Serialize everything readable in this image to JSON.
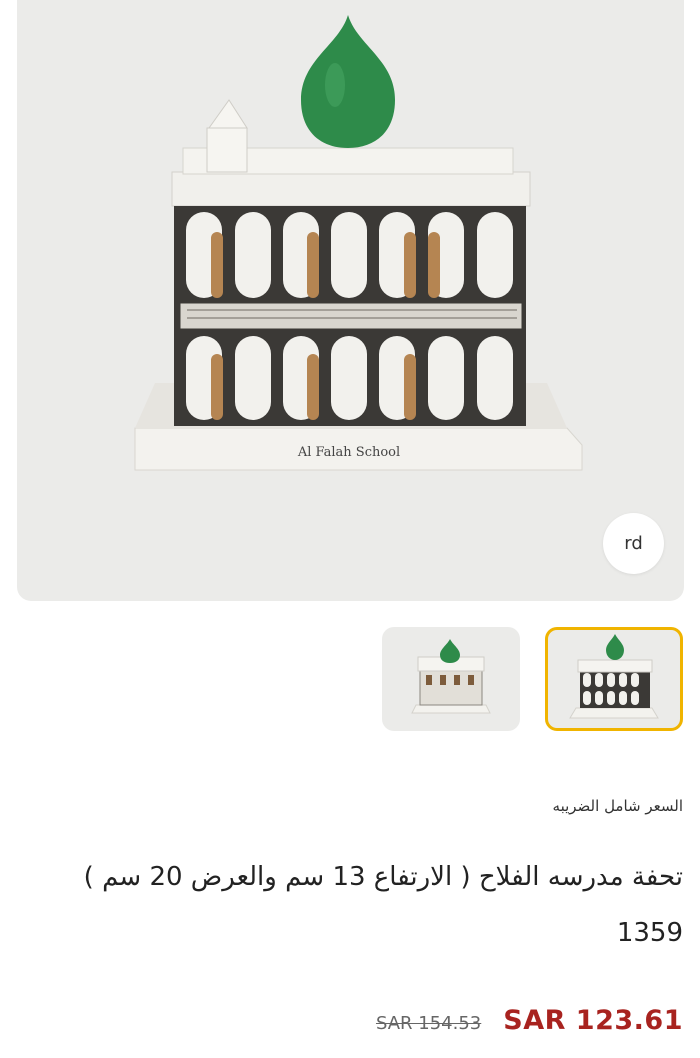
{
  "product": {
    "image_alt": "Al Falah School",
    "badge": "rd",
    "model_caption": "Al Falah School",
    "tax_note": "السعر شامل الضريبه",
    "title": "تحفة مدرسه الفلاح ( الارتفاع 13 سم والعرض 20 سم ) 1359",
    "old_price": "SAR 154.53",
    "new_price": "SAR 123.61"
  },
  "gallery": {
    "thumbnails": [
      {
        "label": "thumbnail-1",
        "selected": false
      },
      {
        "label": "thumbnail-2",
        "selected": true
      }
    ]
  },
  "colors": {
    "accent": "#f0b400",
    "price": "#a8231f",
    "dome": "#2e8b4a"
  }
}
